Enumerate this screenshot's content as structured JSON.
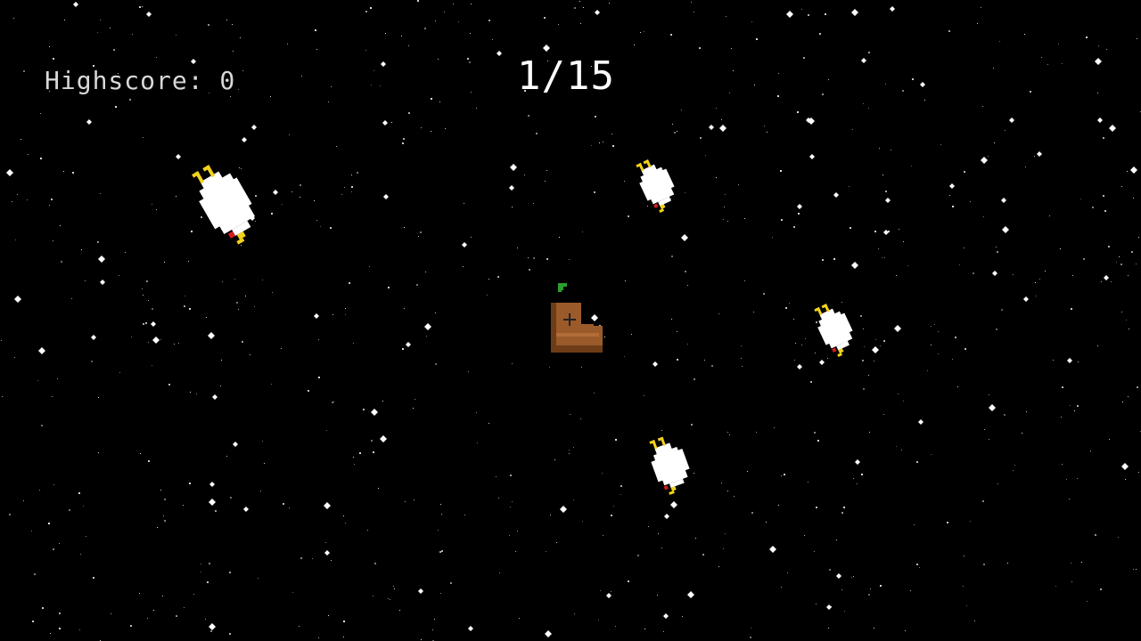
{
  "hud": {
    "highscore_text": "Highscore: 0",
    "wave_text": "1/15"
  },
  "colors": {
    "background": "#000000",
    "star": "#ffffff",
    "chicken_body": "#ffffff",
    "chicken_feet": "#f2d21a",
    "chicken_comb": "#d81e1e",
    "boot_brown": "#9a5a2a",
    "boot_dark": "#6e3d18",
    "sprout_green": "#2e9e2e"
  },
  "icons": {
    "enemy": "space-chicken-icon",
    "player": "boot-sprout-icon",
    "cursor": "crosshair-icon"
  }
}
